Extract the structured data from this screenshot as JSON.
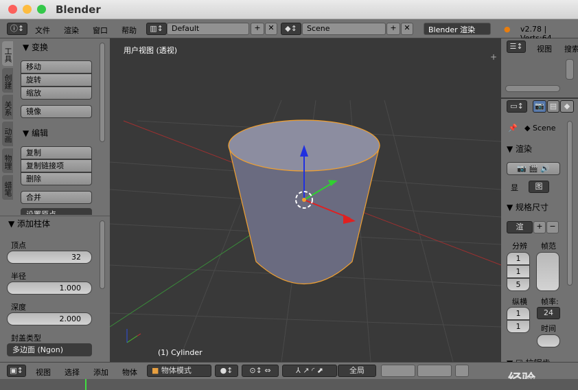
{
  "window": {
    "title": "Blender"
  },
  "menu": {
    "items": [
      "文件",
      "渲染",
      "窗口",
      "帮助"
    ],
    "layout": "Default",
    "scene": "Scene",
    "engine": "Blender 渲染",
    "version": "v2.78 | Verts:64"
  },
  "tool_tabs": [
    "工具",
    "创建",
    "关系",
    "动画",
    "物理",
    "蜡笔"
  ],
  "transform": {
    "title": "变换",
    "buttons": [
      "移动",
      "旋转",
      "缩放"
    ],
    "mirror": "镜像"
  },
  "edit": {
    "title": "编辑",
    "buttons": [
      "复制",
      "复制链接项",
      "删除"
    ],
    "join": "合并",
    "origin": "设置原点"
  },
  "operator": {
    "title": "添加柱体",
    "vertices_label": "顶点",
    "vertices": "32",
    "radius_label": "半径",
    "radius": "1.000",
    "depth_label": "深度",
    "depth": "2.000",
    "cap_label": "封盖类型",
    "cap": "多边面 (Ngon)"
  },
  "viewport": {
    "title": "用户视图 (透视)",
    "object": "(1) Cylinder",
    "selection_color": "#f0a030"
  },
  "outliner": {
    "view": "视图",
    "search": "搜索"
  },
  "properties": {
    "scene": "Scene",
    "render_title": "渲染",
    "display_label": "显",
    "display_value": "图",
    "dimensions_title": "规格尺寸",
    "preset": "渲",
    "resolution_label": "分辨",
    "frame_range_label": "帧范",
    "res_values": [
      "1",
      "1",
      "5"
    ],
    "aspect_label": "纵横",
    "aspect_values": [
      "1",
      "1"
    ],
    "fps_label": "帧率:",
    "fps": "24",
    "time_label": "时间",
    "aa_label": "抗锯齿"
  },
  "bottom": {
    "menus": [
      "视图",
      "选择",
      "添加",
      "物体"
    ],
    "mode": "物体模式",
    "orientation": "全局"
  },
  "watermark": "经验"
}
